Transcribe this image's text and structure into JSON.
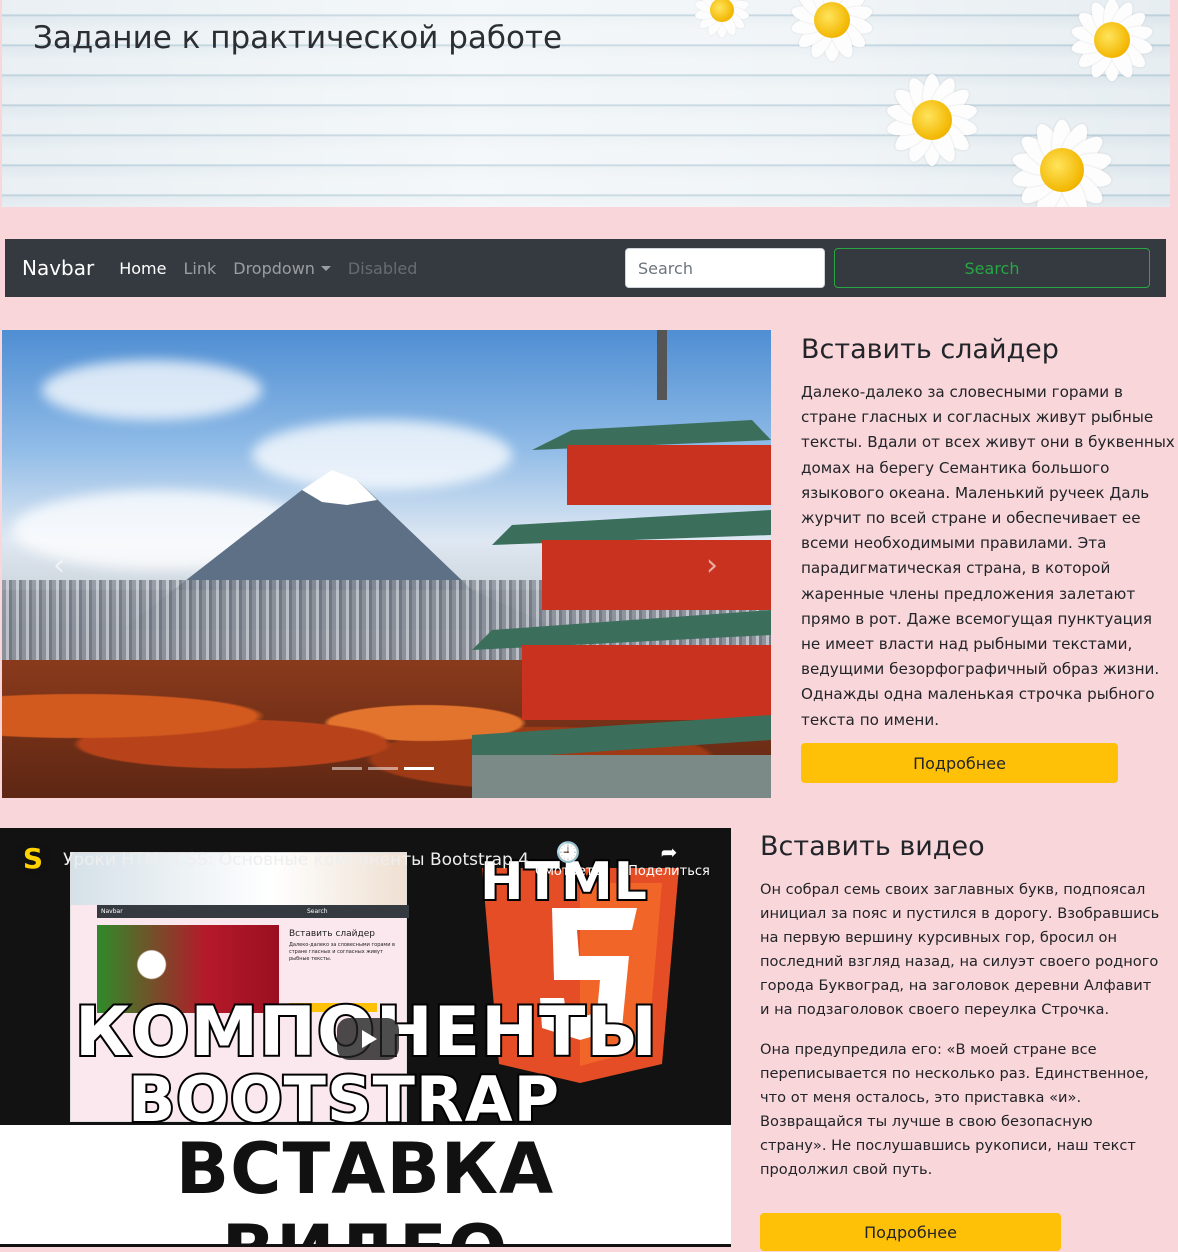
{
  "header": {
    "title": "Задание к практической работе"
  },
  "navbar": {
    "brand": "Navbar",
    "links": [
      {
        "label": "Home",
        "state": "active"
      },
      {
        "label": "Link",
        "state": "normal"
      },
      {
        "label": "Dropdown",
        "state": "dropdown"
      },
      {
        "label": "Disabled",
        "state": "disabled"
      }
    ],
    "search": {
      "placeholder": "Search",
      "value": "",
      "button_label": "Search"
    }
  },
  "slider": {
    "prev_icon": "‹",
    "next_icon": "›",
    "slide_count": 3,
    "active_slide": 3
  },
  "section1": {
    "heading": "Вставить слайдер",
    "text": "Далеко-далеко за словесными горами в стране гласных и согласных живут рыбные тексты. Вдали от всех живут они в буквенных домах на берегу Семантика большого языкового океана. Маленький ручеек Даль журчит по всей стране и обеспечивает ее всеми необходимыми правилами. Эта парадигматическая страна, в которой жаренные члены предложения залетают прямо в рот. Даже всемогущая пунктуация не имеет власти над рыбными текстами, ведущими безорфографичный образ жизни. Однажды одна маленькая строчка рыбного текста по имени.",
    "button_label": "Подробнее"
  },
  "video": {
    "channel_icon": "S",
    "title": "Уроки HTML/CSS: Основные компоненты Bootstrap 4",
    "watch_label": "Смотреть",
    "share_label": "Поделиться",
    "thumb_html": "HTML",
    "thumb_five": "5",
    "thumb_line1": "КОМПОНЕНТЫ",
    "thumb_line2": "BOOTSTRAP",
    "thumb_line3": "ВСТАВКА ВИДЕО",
    "inner_brand": "Navbar",
    "inner_heading": "Вставить слайдер",
    "inner_search": "Search",
    "inner_text": "Далеко-далеко за словесными горами в стране гласных и согласных живут рыбные тексты."
  },
  "section2": {
    "heading": "Вставить видео",
    "paragraph1": "Он собрал семь своих заглавных букв, подпоясал инициал за пояс и пустился в дорогу. Взобравшись на первую вершину курсивных гор, бросил он последний взгляд назад, на силуэт своего родного города Буквоград, на заголовок деревни Алфавит и на подзаголовок своего переулка Строчка.",
    "paragraph2": "Она предупредила его: «В моей стране все переписывается по несколько раз. Единственное, что от меня осталось, это приставка «и». Возвращайся ты лучше в свою безопасную страну». Не послушавшись рукописи, наш текст продолжил свой путь.",
    "button_label": "Подробнее"
  }
}
